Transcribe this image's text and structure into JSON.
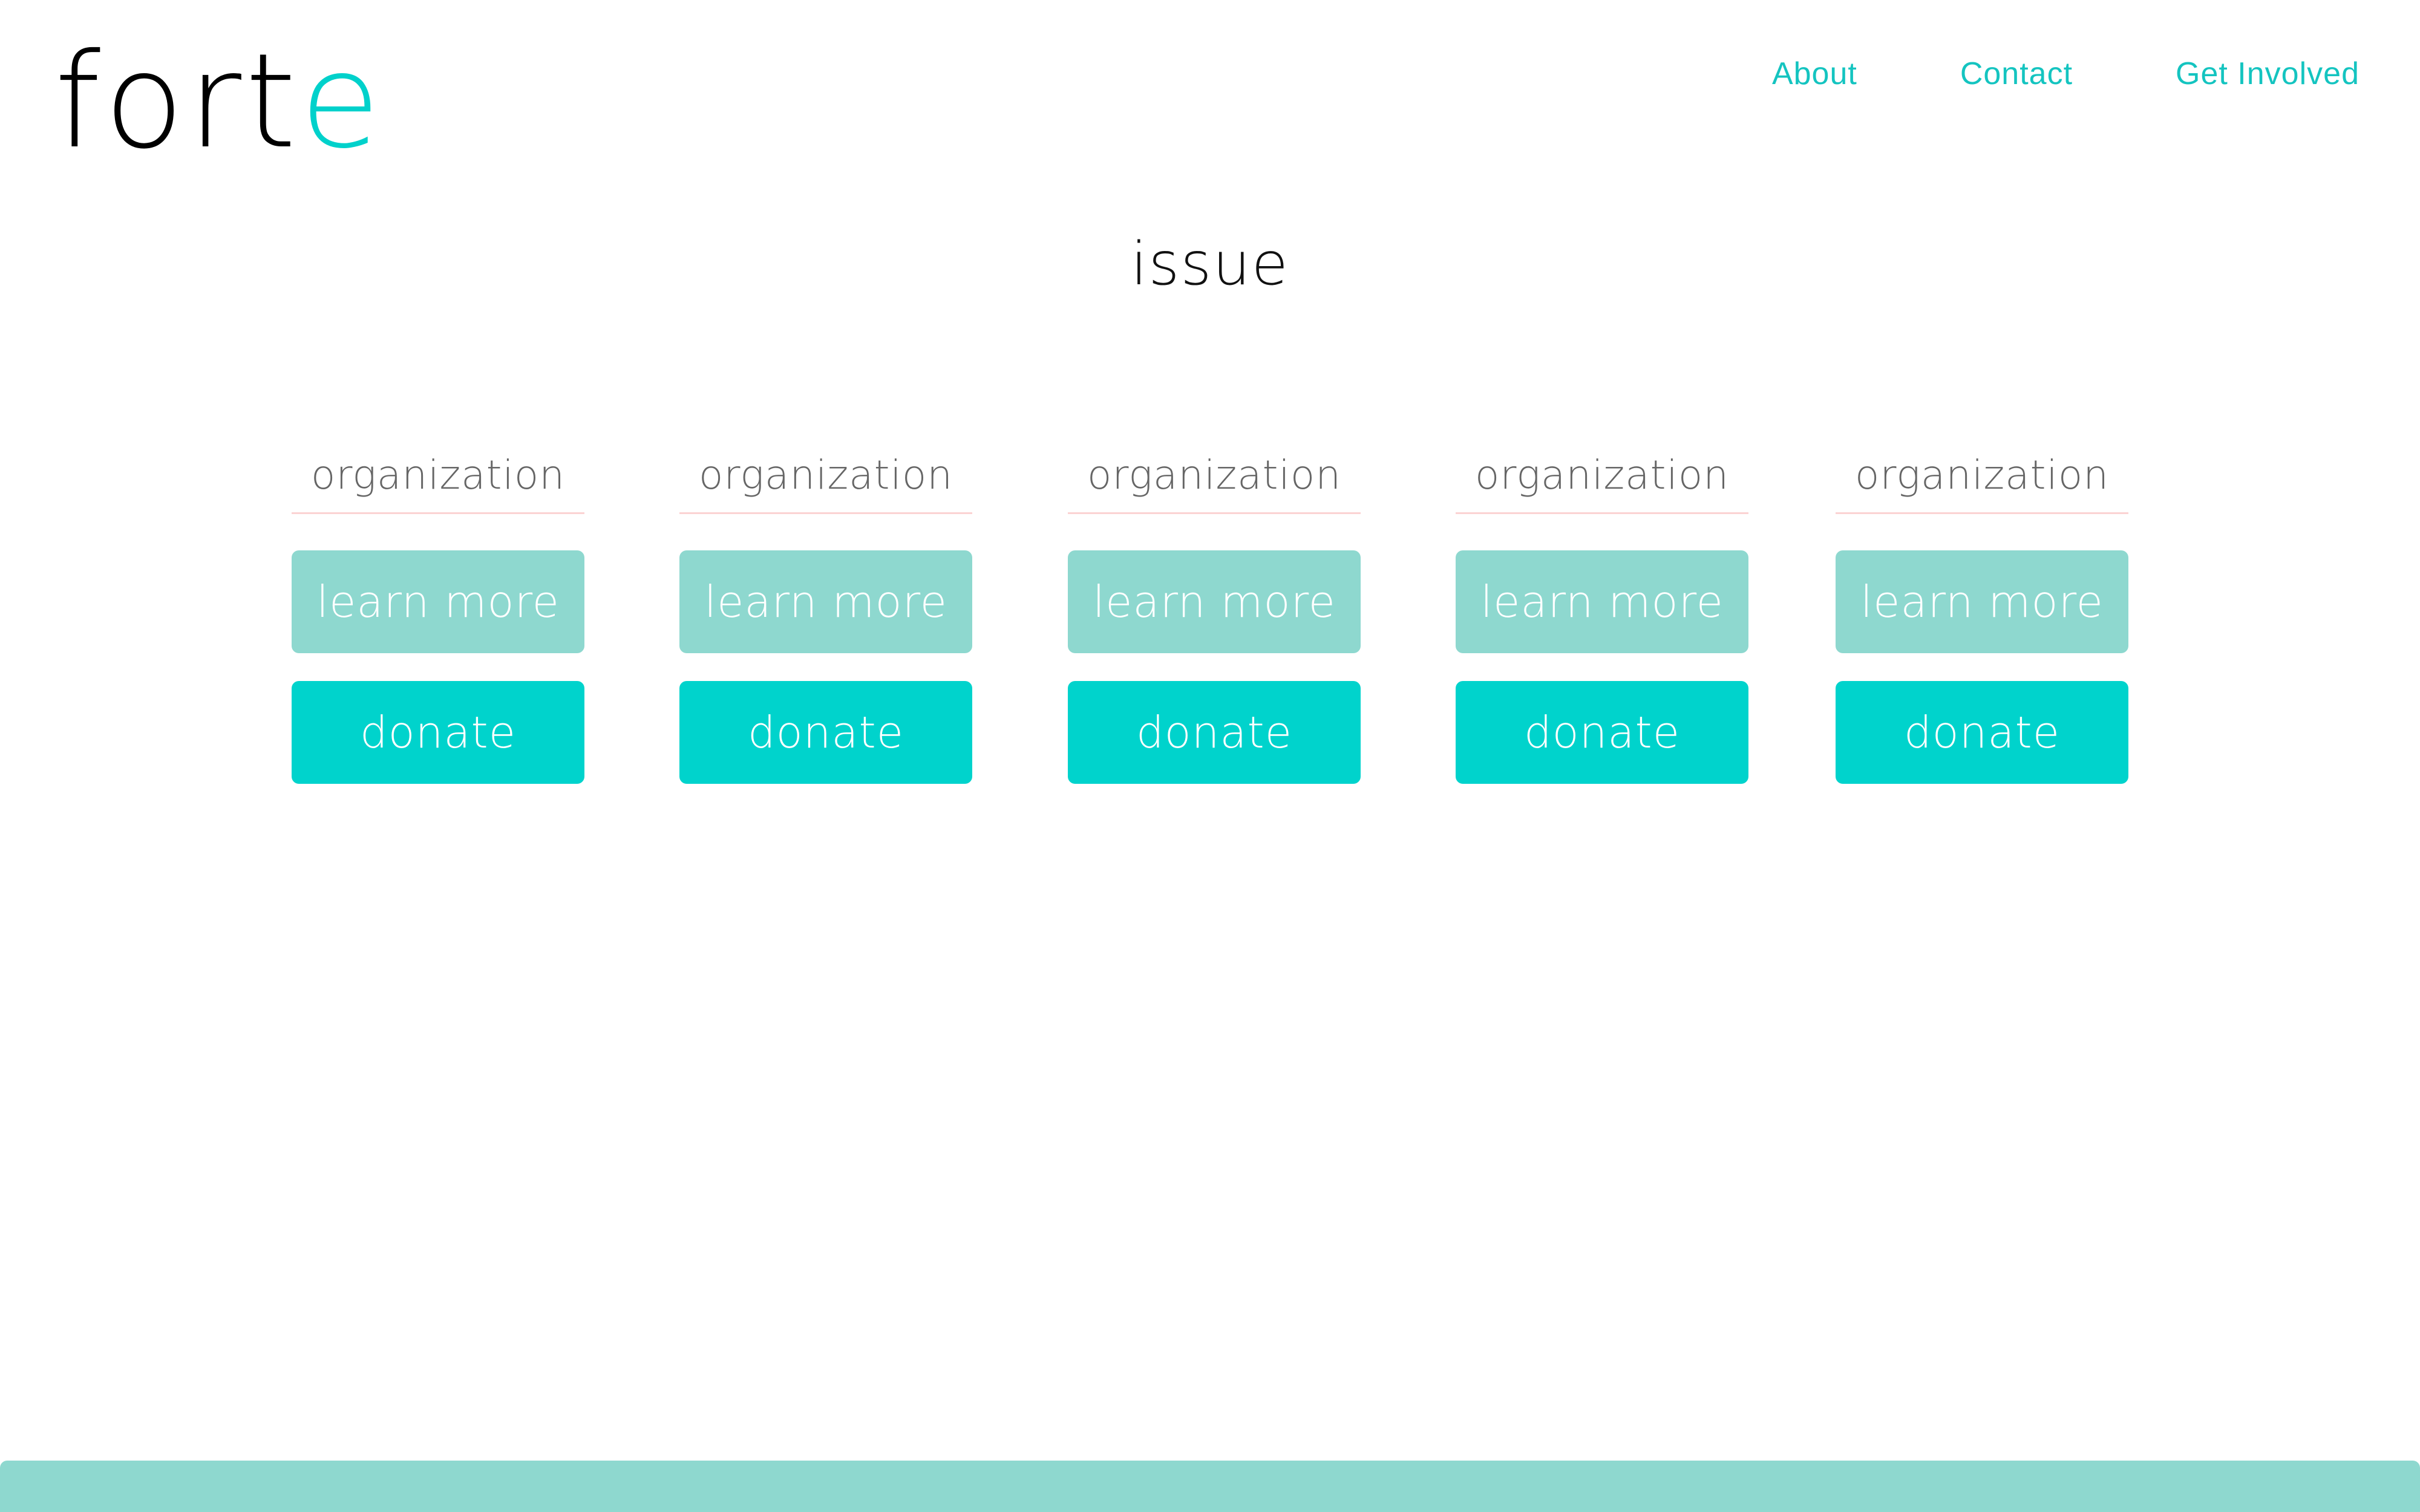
{
  "brand": {
    "logo_prefix": "for",
    "logo_middle": "t",
    "logo_suffix": "e",
    "accent_color": "#00d3cc",
    "muted_accent_color": "#8ed8cf"
  },
  "nav": {
    "items": [
      {
        "label": "About"
      },
      {
        "label": "Contact"
      },
      {
        "label": "Get Involved"
      }
    ]
  },
  "main": {
    "title": "issue",
    "organizations": [
      {
        "name": "organization",
        "learn_label": "learn more",
        "donate_label": "donate"
      },
      {
        "name": "organization",
        "learn_label": "learn more",
        "donate_label": "donate"
      },
      {
        "name": "organization",
        "learn_label": "learn more",
        "donate_label": "donate"
      },
      {
        "name": "organization",
        "learn_label": "learn more",
        "donate_label": "donate"
      },
      {
        "name": "organization",
        "learn_label": "learn more",
        "donate_label": "donate"
      }
    ]
  }
}
